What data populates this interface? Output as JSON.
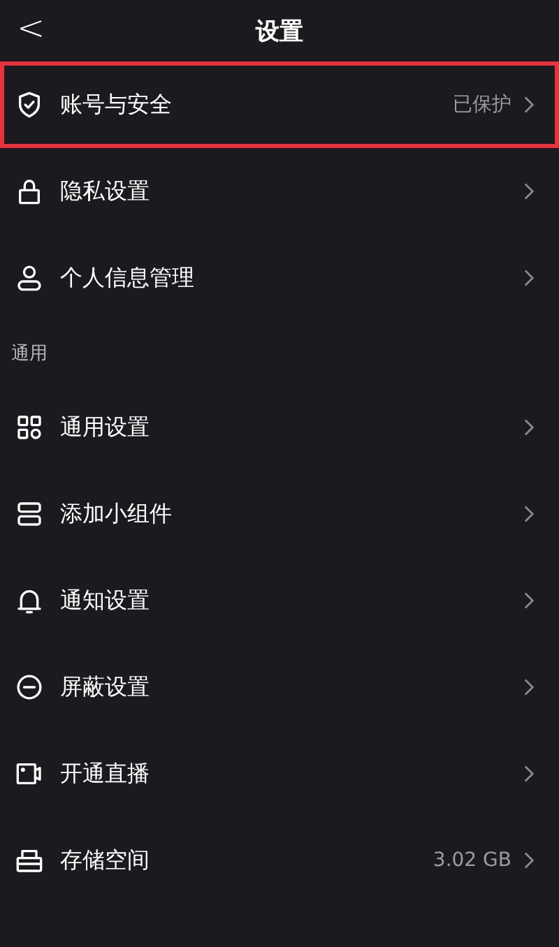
{
  "header": {
    "back": "<",
    "title": "设置"
  },
  "groups": [
    {
      "items": [
        {
          "kind": "shield",
          "label": "账号与安全",
          "value": "已保护",
          "highlighted": true
        },
        {
          "kind": "lock",
          "label": "隐私设置",
          "highlighted": false
        },
        {
          "kind": "person",
          "label": "个人信息管理",
          "highlighted": false
        }
      ]
    },
    {
      "title": "通用",
      "items": [
        {
          "kind": "grid",
          "label": "通用设置",
          "highlighted": false
        },
        {
          "kind": "widget",
          "label": "添加小组件",
          "highlighted": false
        },
        {
          "kind": "bell",
          "label": "通知设置",
          "highlighted": false
        },
        {
          "kind": "minus",
          "label": "屏蔽设置",
          "highlighted": false
        },
        {
          "kind": "camera",
          "label": "开通直播",
          "highlighted": false
        },
        {
          "kind": "case",
          "label": "存储空间",
          "value": "3.02 GB",
          "highlighted": false
        }
      ]
    }
  ]
}
